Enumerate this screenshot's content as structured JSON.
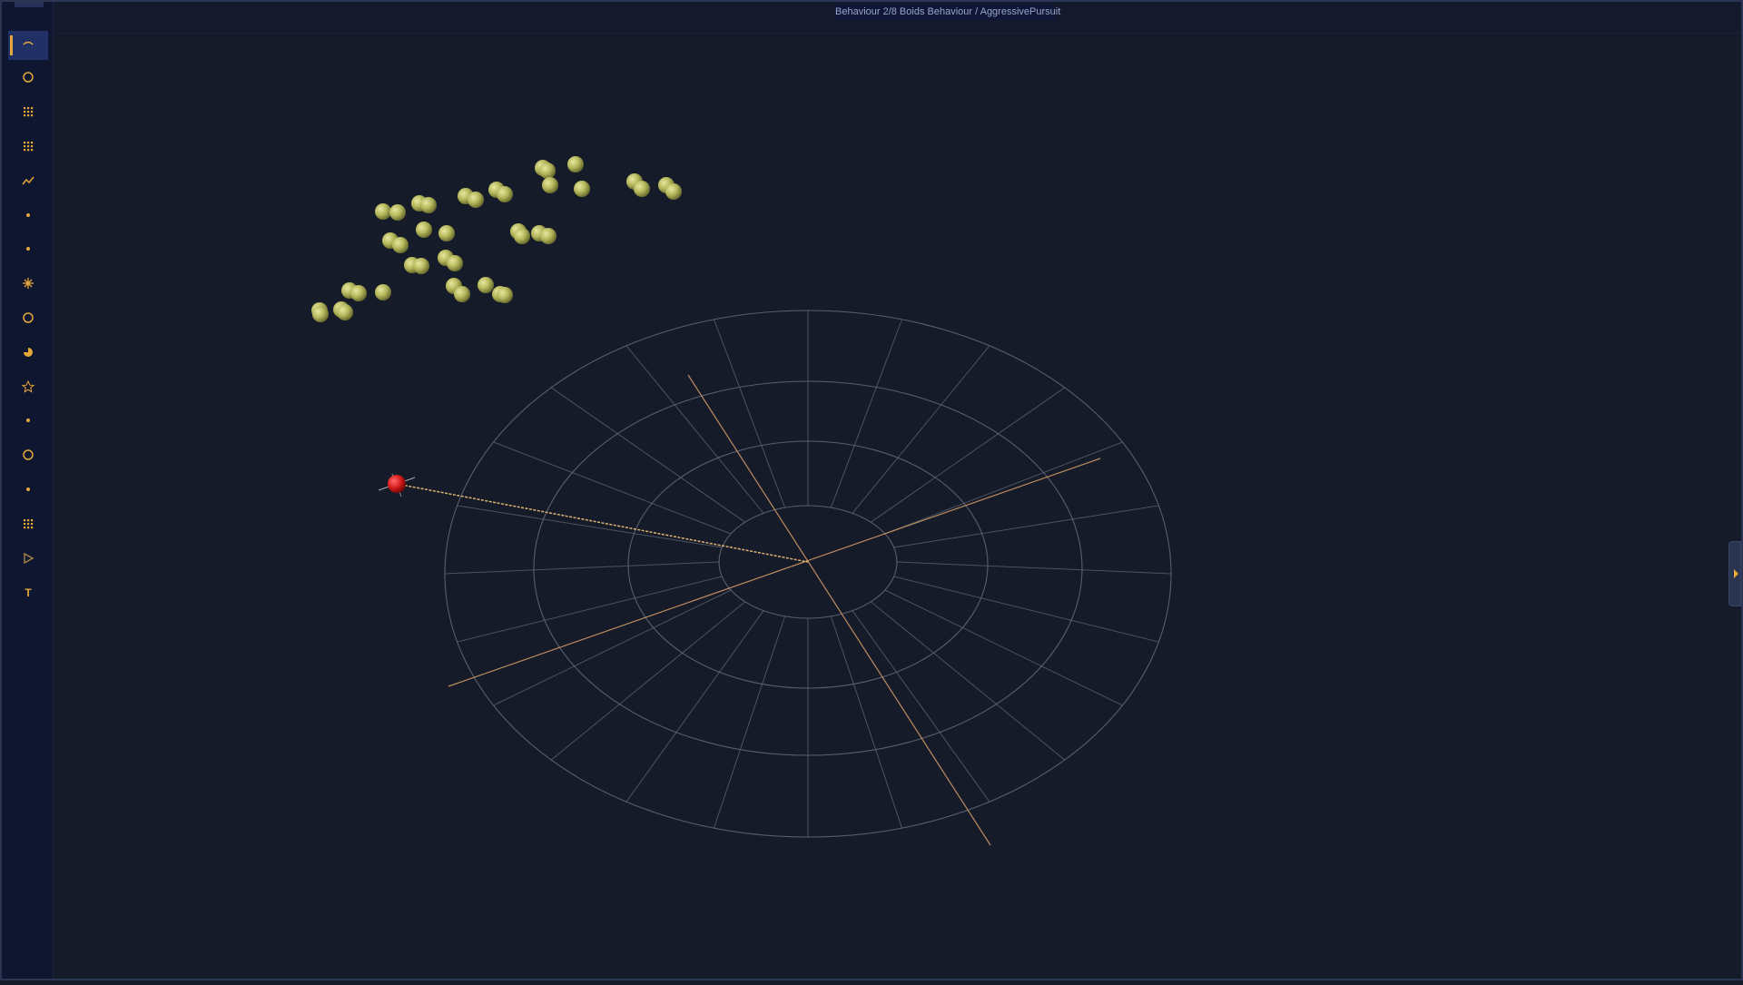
{
  "header": {
    "status_text": "Behaviour 2/8  Boids Behaviour / AggressivePursuit"
  },
  "colors": {
    "background": "#161b29",
    "sidebar": "#0f1630",
    "accent": "#e7a83a",
    "grid": "#646a7a",
    "axis": "#d9a068",
    "boid": "#b5b85c",
    "predator": "#d61a1a"
  },
  "toolbar": {
    "tools": [
      {
        "icon": "arc-icon",
        "active": true
      },
      {
        "icon": "circle-icon"
      },
      {
        "icon": "grid-dots-icon"
      },
      {
        "icon": "grid-dots-icon"
      },
      {
        "icon": "line-chart-icon"
      },
      {
        "icon": "dot-icon"
      },
      {
        "icon": "dot-icon"
      },
      {
        "icon": "sparkle-icon"
      },
      {
        "icon": "circle-icon"
      },
      {
        "icon": "pie-icon"
      },
      {
        "icon": "star-icon"
      },
      {
        "icon": "dot-icon"
      },
      {
        "icon": "circle-icon"
      },
      {
        "icon": "dot-icon"
      },
      {
        "icon": "grid-dots-icon"
      },
      {
        "icon": "play-icon"
      },
      {
        "icon": "text-icon"
      }
    ]
  },
  "scene": {
    "boid_count": 41,
    "predator_count": 1,
    "grid": "polar"
  }
}
